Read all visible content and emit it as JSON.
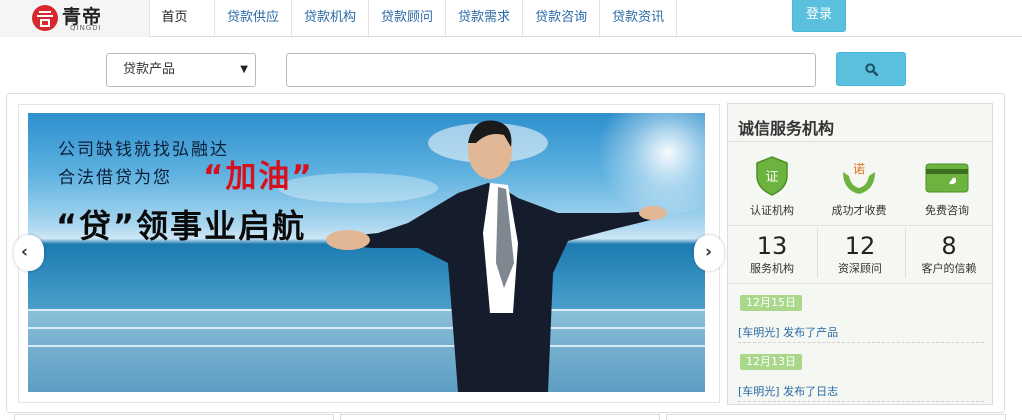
{
  "header": {
    "logo_name": "青帝",
    "logo_sub": "QINGDI",
    "nav": [
      {
        "label": "首页"
      },
      {
        "label": "贷款供应"
      },
      {
        "label": "贷款机构"
      },
      {
        "label": "贷款顾问"
      },
      {
        "label": "贷款需求"
      },
      {
        "label": "贷款咨询"
      },
      {
        "label": "贷款资讯"
      }
    ],
    "login": "登录"
  },
  "search": {
    "category": "贷款产品",
    "query": "",
    "button_icon": "search-icon"
  },
  "banner": {
    "line1": "公司缺钱就找弘融达",
    "line2": "合法借贷为您",
    "highlight": "“加油”",
    "line3": "“贷”领事业启航"
  },
  "sidebar": {
    "title": "诚信服务机构",
    "badges": [
      {
        "icon": "certified-shield-icon",
        "label": "认证机构"
      },
      {
        "icon": "promise-hands-icon",
        "label": "成功才收费"
      },
      {
        "icon": "phone-card-icon",
        "label": "免费咨询"
      }
    ],
    "stats": [
      {
        "value": "13",
        "label": "服务机构"
      },
      {
        "value": "12",
        "label": "资深顾问"
      },
      {
        "value": "8",
        "label": "客户的信赖"
      }
    ],
    "feed": [
      {
        "date": "12月15日",
        "text": "[车明光] 发布了产品"
      },
      {
        "date": "12月13日",
        "text": "[车明光] 发布了日志"
      }
    ]
  },
  "colors": {
    "accent": "#5bc0de",
    "link": "#2a6aa6",
    "highlight_red": "#d8101d",
    "date_badge": "#a9d88b"
  }
}
